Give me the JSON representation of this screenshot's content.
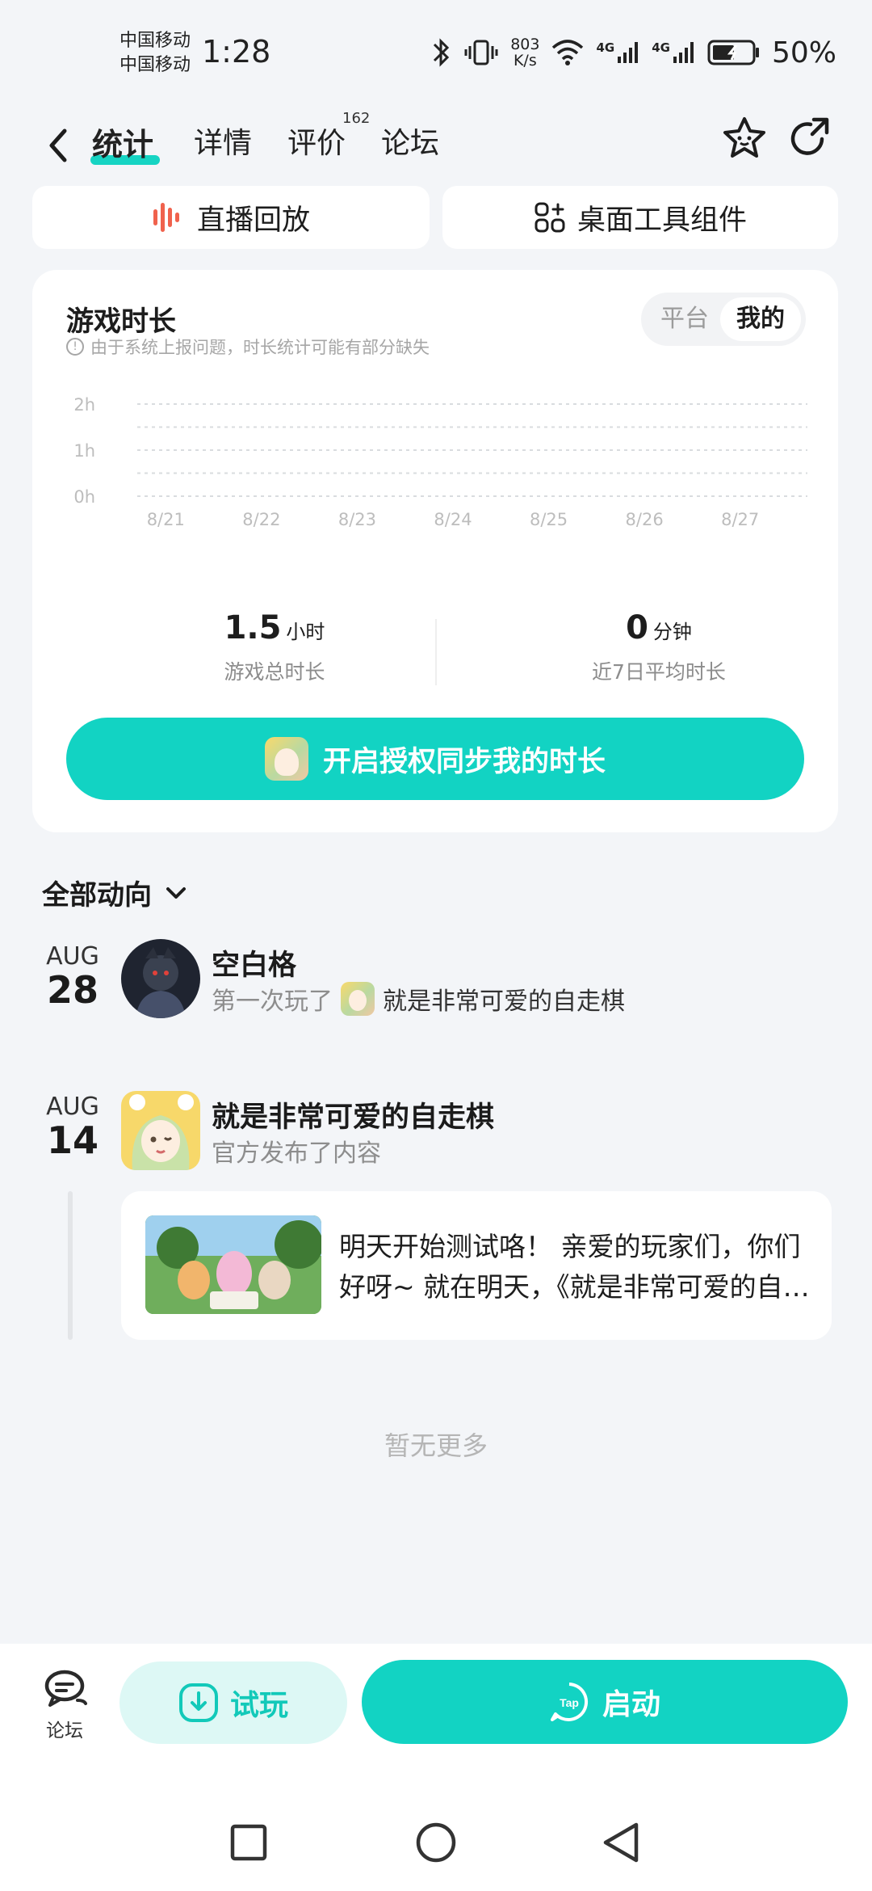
{
  "status": {
    "carrier1": "中国移动",
    "carrier2": "中国移动",
    "time": "1:28",
    "speed_value": "803",
    "speed_unit": "K/s",
    "net1": "4G",
    "net2": "4G",
    "battery": "50%"
  },
  "nav": {
    "tabs": [
      {
        "label": "统计"
      },
      {
        "label": "详情"
      },
      {
        "label": "评价"
      },
      {
        "label": "论坛"
      }
    ],
    "review_count": "162"
  },
  "tools": {
    "replay_label": "直播回放",
    "widget_label": "桌面工具组件"
  },
  "playtime": {
    "title": "游戏时长",
    "note": "由于系统上报问题，时长统计可能有部分缺失",
    "toggle": {
      "platform": "平台",
      "mine": "我的"
    },
    "total_value": "1.5",
    "total_unit": "小时",
    "total_label": "游戏总时长",
    "avg_value": "0",
    "avg_unit": "分钟",
    "avg_label": "近7日平均时长",
    "auth_button": "开启授权同步我的时长"
  },
  "chart_data": {
    "type": "bar",
    "categories": [
      "8/21",
      "8/22",
      "8/23",
      "8/24",
      "8/25",
      "8/26",
      "8/27"
    ],
    "values": [
      0,
      0,
      0,
      0,
      0,
      0,
      0
    ],
    "y_ticks": [
      "0h",
      "1h",
      "2h"
    ],
    "ylim": [
      0,
      2
    ],
    "grid": true
  },
  "feed": {
    "filter_label": "全部动向",
    "items": [
      {
        "month": "AUG",
        "day": "28",
        "name": "空白格",
        "action": "第一次玩了",
        "game": "就是非常可爱的自走棋"
      },
      {
        "month": "AUG",
        "day": "14",
        "name": "就是非常可爱的自走棋",
        "action": "官方发布了内容",
        "post_text": "明天开始测试咯！ 亲爱的玩家们，你们好呀~ 就在明天，《就是非常可爱的自走棋》"
      }
    ],
    "no_more": "暂无更多"
  },
  "bottom": {
    "forum_label": "论坛",
    "trial_label": "试玩",
    "launch_label": "启动"
  },
  "colors": {
    "accent": "#12d3c3",
    "accent_light": "#ddf8f5",
    "background": "#f3f5f8",
    "replay_icon": "#f0624d"
  }
}
